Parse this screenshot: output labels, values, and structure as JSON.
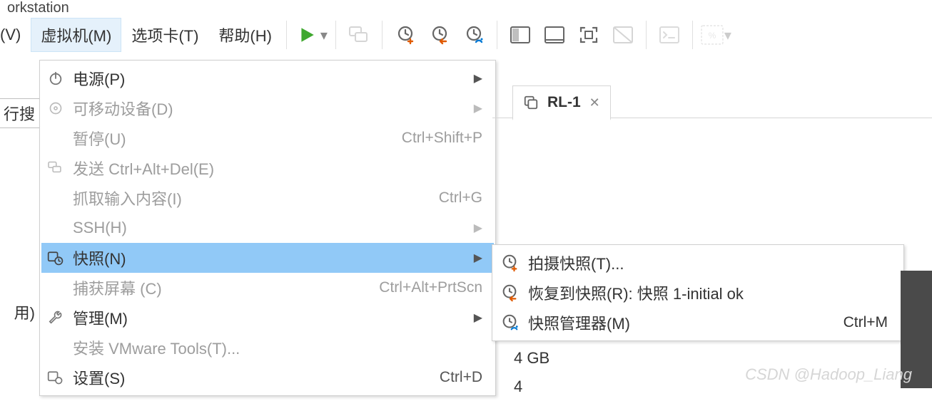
{
  "title_fragment": "orkstation",
  "menubar": {
    "view": "(V)",
    "vm": "虚拟机(M)",
    "tabs": "选项卡(T)",
    "help": "帮助(H)"
  },
  "left_fragments": {
    "search": "行搜",
    "yong": "用)"
  },
  "vm_menu": {
    "power": "电源(P)",
    "removable": "可移动设备(D)",
    "pause": "暂停(U)",
    "pause_sc": "Ctrl+Shift+P",
    "send_cad": "发送 Ctrl+Alt+Del(E)",
    "grab_input": "抓取输入内容(I)",
    "grab_input_sc": "Ctrl+G",
    "ssh": "SSH(H)",
    "snapshot": "快照(N)",
    "capture": "捕获屏幕 (C)",
    "capture_sc": "Ctrl+Alt+PrtScn",
    "manage": "管理(M)",
    "install_tools": "安装 VMware Tools(T)...",
    "settings": "设置(S)",
    "settings_sc": "Ctrl+D"
  },
  "snapshot_menu": {
    "take": "拍摄快照(T)...",
    "revert": "恢复到快照(R): 快照 1-initial ok",
    "manager": "快照管理器(M)",
    "manager_sc": "Ctrl+M"
  },
  "tab": {
    "name": "RL-1"
  },
  "details": {
    "memory": "4 GB",
    "cpu": "4"
  },
  "watermark": "CSDN @Hadoop_Liang"
}
